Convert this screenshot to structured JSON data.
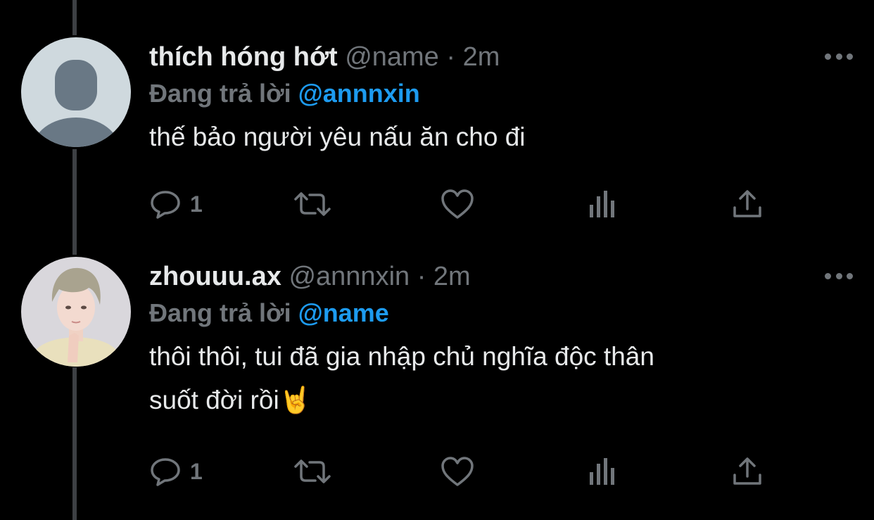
{
  "colors": {
    "background": "#000000",
    "text": "#e7e9ea",
    "muted": "#71767b",
    "mention": "#1d9bf0",
    "thread_line": "#3d4044"
  },
  "tweets": [
    {
      "display_name": "thích hóng hớt",
      "handle": "@name",
      "separator": "·",
      "time": "2m",
      "reply_prefix": "Đang trả lời",
      "reply_to": "@annnxin",
      "text_lines": [
        "thế bảo người yêu nấu ăn cho đi"
      ],
      "avatar": "default-avatar-icon",
      "actions": {
        "reply_count": "1",
        "icons": [
          "reply-icon",
          "retweet-icon",
          "like-icon",
          "analytics-icon",
          "share-icon"
        ]
      }
    },
    {
      "display_name": "zhouuu.ax",
      "handle": "@annnxin",
      "separator": "·",
      "time": "2m",
      "reply_prefix": "Đang trả lời",
      "reply_to": "@name",
      "text_lines": [
        "thôi thôi, tui đã gia nhập chủ nghĩa độc thân",
        "suốt đời rồi🤘"
      ],
      "avatar": "profile-photo",
      "actions": {
        "reply_count": "1",
        "icons": [
          "reply-icon",
          "retweet-icon",
          "like-icon",
          "analytics-icon",
          "share-icon"
        ]
      }
    }
  ]
}
